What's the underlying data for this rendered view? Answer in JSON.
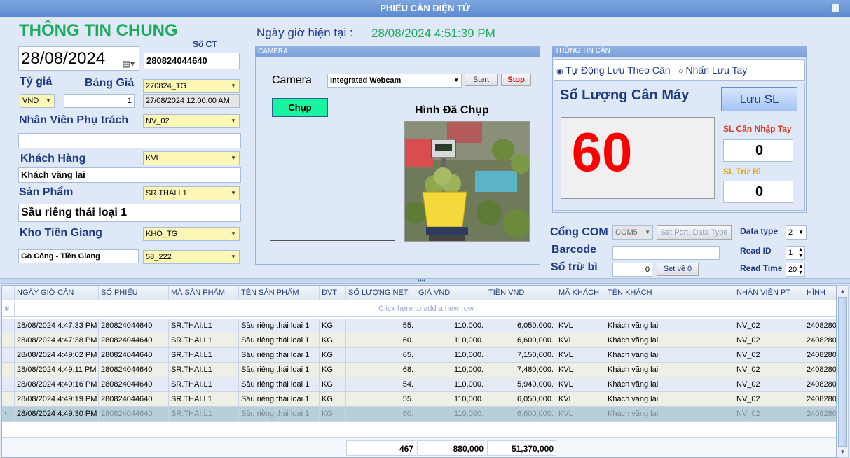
{
  "window": {
    "title": "PHIẾU CÂN ĐIỆN TỬ"
  },
  "info": {
    "heading": "THÔNG TIN CHUNG",
    "date": "28/08/2024",
    "so_ct_label": "Số CT",
    "so_ct": "280824044640",
    "ty_gia_label": "Tỷ giá",
    "currency": "VND",
    "rate": "1",
    "bang_gia_label": "Bảng Giá",
    "bang_gia": "270824_TG",
    "bang_gia_date": "27/08/2024 12:00:00 AM",
    "nv_label": "Nhân Viên Phụ trách",
    "nv": "NV_02",
    "nv_name": "",
    "kh_label": "Khách Hàng",
    "kh": "KVL",
    "kh_name": "Khách vãng lai",
    "sp_label": "Sản Phẩm",
    "sp": "SR.THAI.L1",
    "sp_name": "Sầu riêng thái loại 1",
    "kho_label": "Kho Tiền Giang",
    "kho": "KHO_TG",
    "kho_name": "Gò Công - Tiền Giang",
    "kho_code": "58_222"
  },
  "clock": {
    "label": "Ngày giờ hiện tại :",
    "value": "28/08/2024 4:51:39 PM"
  },
  "camera": {
    "header": "CAMERA",
    "label": "Camera",
    "device": "Integrated Webcam",
    "start": "Start",
    "stop": "Stop",
    "capture": "Chụp",
    "captured_label": "Hình Đã Chụp"
  },
  "scale": {
    "header": "THÔNG TIN CÂN",
    "mode_auto": "Tự Động Lưu Theo Cân",
    "mode_manual": "Nhấn Lưu Tay",
    "reading_label": "Số Lượng Cân Máy",
    "save_btn": "Lưu SL",
    "reading": "60",
    "manual_label": "SL Cân Nhập Tay",
    "manual_value": "0",
    "minus_label": "SL Trừ Bì",
    "minus_value": "0"
  },
  "port": {
    "com_label": "Cổng COM",
    "com": "COM5",
    "set_port": "Set Port, Data Type",
    "data_type_label": "Data type",
    "data_type": "2",
    "barcode_label": "Barcode",
    "barcode": "",
    "read_id_label": "Read ID",
    "read_id": "1",
    "so_tru_bi_label": "Số trừ bì",
    "so_tru_bi": "0",
    "set_zero": "Set về 0",
    "read_time_label": "Read Time",
    "read_time": "20"
  },
  "grid": {
    "columns": [
      "NGÀY GIỜ CÂN",
      "SỐ PHIẾU",
      "MÃ SẢN PHẨM",
      "TÊN SẢN PHẨM",
      "ĐVT",
      "SỐ LƯỢNG NET",
      "GIÁ VND",
      "TIỀN VND",
      "MÃ KHÁCH",
      "TÊN KHÁCH",
      "NHÂN VIÊN PT",
      "HÌNH"
    ],
    "new_row_hint": "Click here to add a new row",
    "rows": [
      [
        "28/08/2024 4:47:33 PM",
        "280824044640",
        "SR.THAI.L1",
        "Sầu riêng thái loại 1",
        "KG",
        "55.",
        "110,000.",
        "6,050,000.",
        "KVL",
        "Khách vãng lai",
        "NV_02",
        "2408280"
      ],
      [
        "28/08/2024 4:47:38 PM",
        "280824044640",
        "SR.THAI.L1",
        "Sầu riêng thái loại 1",
        "KG",
        "60.",
        "110,000.",
        "6,600,000.",
        "KVL",
        "Khách vãng lai",
        "NV_02",
        "2408280"
      ],
      [
        "28/08/2024 4:49:02 PM",
        "280824044640",
        "SR.THAI.L1",
        "Sầu riêng thái loại 1",
        "KG",
        "65.",
        "110,000.",
        "7,150,000.",
        "KVL",
        "Khách vãng lai",
        "NV_02",
        "2408280"
      ],
      [
        "28/08/2024 4:49:11 PM",
        "280824044640",
        "SR.THAI.L1",
        "Sầu riêng thái loại 1",
        "KG",
        "68.",
        "110,000.",
        "7,480,000.",
        "KVL",
        "Khách vãng lai",
        "NV_02",
        "2408280"
      ],
      [
        "28/08/2024 4:49:16 PM",
        "280824044640",
        "SR.THAI.L1",
        "Sầu riêng thái loại 1",
        "KG",
        "54.",
        "110,000.",
        "5,940,000.",
        "KVL",
        "Khách vãng lai",
        "NV_02",
        "2408280"
      ],
      [
        "28/08/2024 4:49:19 PM",
        "280824044640",
        "SR.THAI.L1",
        "Sầu riêng thái loại 1",
        "KG",
        "55.",
        "110,000.",
        "6,050,000.",
        "KVL",
        "Khách vãng lai",
        "NV_02",
        "2408280"
      ],
      [
        "28/08/2024 4:49:30 PM",
        "280824044640",
        "SR.THAI.L1",
        "Sầu riêng thái loại 1",
        "KG",
        "60.",
        "110,000.",
        "6,600,000.",
        "KVL",
        "Khách vãng lai",
        "NV_02",
        "2408280"
      ]
    ],
    "totals": {
      "qty": "467",
      "price": "880,000",
      "amount": "51,370,000"
    }
  },
  "colors": {
    "accent": "#1e3c84",
    "heading_green": "#1aab5b",
    "reading_red": "#ff0000",
    "combo_yellow": "#fdf7b7"
  }
}
